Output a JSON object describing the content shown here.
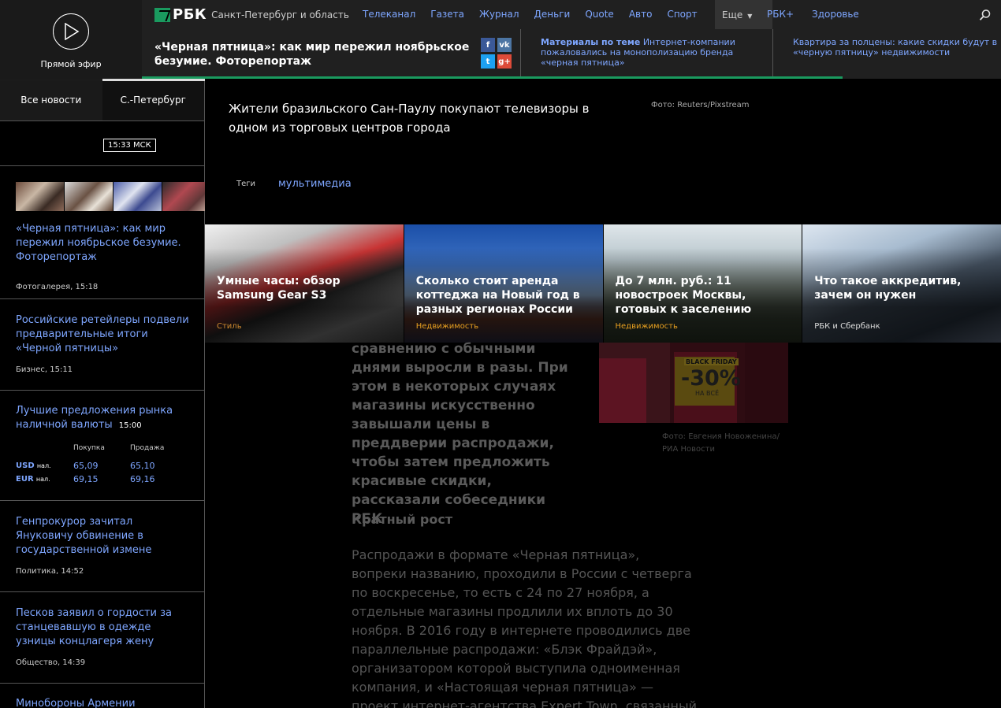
{
  "live": {
    "label": "Прямой эфир"
  },
  "topnav": {
    "logo": "РБК",
    "region": "Санкт-Петербург и область",
    "links": [
      "Телеканал",
      "Газета",
      "Журнал",
      "Деньги",
      "Quote",
      "Авто",
      "Спорт"
    ],
    "more": "Еще",
    "rbk_plus": "РБК+",
    "health": "Здоровье"
  },
  "strip": {
    "headline": "«Черная пятница»: как мир пережил ноябрьское безумие. Фоторепортаж",
    "related_label": "Материалы по теме",
    "related_text": "Интернет-компании пожаловались на монополизацию бренда «черная пятница»",
    "related2": "Квартира за полцены: какие скидки будут в «черную пятницу» недвижимости",
    "progress_fraction": 0.816
  },
  "left": {
    "tabs": [
      "Все новости",
      "С.-Петербург"
    ],
    "time": "15:33 МСК",
    "news": [
      {
        "title": "«Черная пятница»: как мир пережил ноябрьское безумие. Фоторепортаж",
        "meta": "Фотогалерея, 15:18"
      },
      {
        "title": "Российские ретейлеры подвели предварительные итоги «Черной пятницы»",
        "meta": "Бизнес, 15:11"
      },
      {
        "title": "Генпрокурор зачитал Януковичу обвинение в государственной измене",
        "meta": "Политика, 14:52"
      },
      {
        "title": "Песков заявил о гордости за станцевавшую в одежде узницы концлагеря жену",
        "meta": "Общество, 14:39"
      },
      {
        "title": "Минобороны Армении допустило",
        "meta": ""
      }
    ],
    "fx": {
      "title": "Лучшие предложения рынка наличной валюты",
      "time": "15:00",
      "buy": "Покупка",
      "sell": "Продажа",
      "rows": [
        {
          "cur": "USD",
          "suffix": "нал.",
          "buy": "65,09",
          "sell": "65,10"
        },
        {
          "cur": "EUR",
          "suffix": "нал.",
          "buy": "69,15",
          "sell": "69,16"
        }
      ]
    }
  },
  "overlay": {
    "caption": "Жители бразильского Сан-Паулу покупают телевизоры в одном из торговых центров города",
    "credit": "Фото: Reuters/Pixstream",
    "tags_label": "Теги",
    "tag": "мультимедиа"
  },
  "cards": [
    {
      "title": "Умные часы: обзор Samsung Gear S3",
      "category": "Стиль",
      "cat_color": "#d08a30"
    },
    {
      "title": "Сколько стоит аренда коттеджа на Новый год в разных регионах России",
      "category": "Недвижимость",
      "cat_color": "#e8a020"
    },
    {
      "title": "До 7 млн. руб.: 11 новостроек Москвы, готовых к заселению",
      "category": "Недвижимость",
      "cat_color": "#e8a020"
    },
    {
      "title": "Что такое аккредитив, зачем он нужен",
      "category": "РБК и Сбербанк",
      "cat_color": "#dddddd"
    }
  ],
  "article": {
    "lead": "сравнению с обычными днями выросли в разы. При этом в некоторых случаях магазины искусственно завышали цены в преддверии распродажи, чтобы затем предложить красивые скидки, рассказали собеседники РБК",
    "subhead": "Кратный рост",
    "body": "Распродажи в формате «Черная пятница», вопреки названию, проходили в России с четверга по воскресенье, то есть с 24 по 27 ноября, а отдельные магазины продлили их вплоть до 30 ноября. В 2016 году в интернете проводились две параллельные распродажи: «Блэк Фрайдэй», организатором которой выступила одноименная компания, и «Настоящая черная пятница» — проект интернет-агентства Expert Town, связанный",
    "photo_credit": "Фото: Евгения Новоженина/РИА Новости",
    "sign1_top": "BLACK FRIDAY",
    "sign1_pct": "-30%",
    "sign1_sub": "НА ВСЁ"
  }
}
